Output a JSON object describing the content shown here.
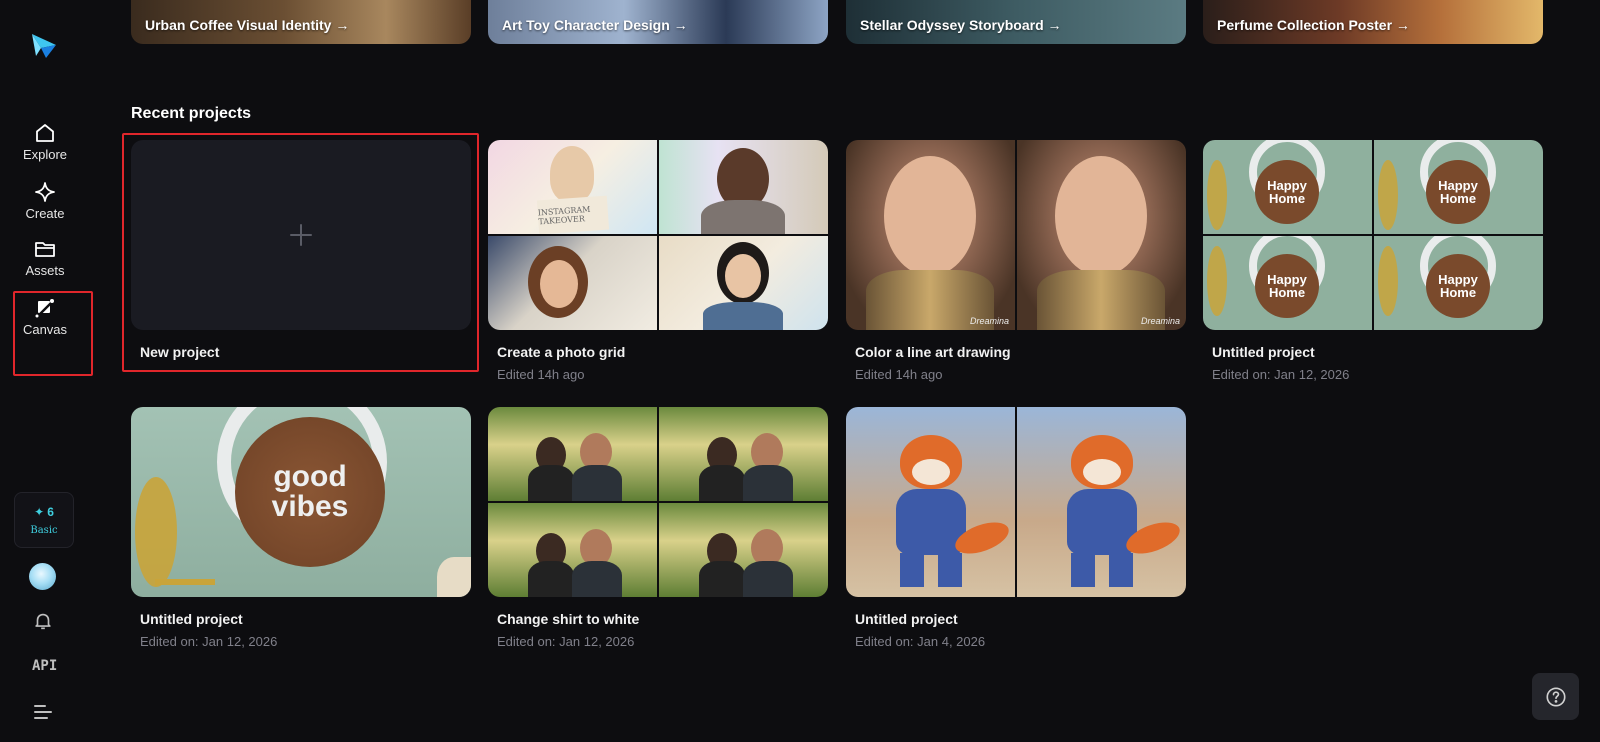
{
  "sidebar": {
    "items": [
      {
        "label": "Explore",
        "icon": "home-icon"
      },
      {
        "label": "Create",
        "icon": "sparkle-icon"
      },
      {
        "label": "Assets",
        "icon": "folder-icon"
      },
      {
        "label": "Canvas",
        "icon": "canvas-icon"
      }
    ],
    "credits": {
      "count": "6",
      "plan": "Basic"
    },
    "api_label": "API"
  },
  "banners": [
    {
      "label": "Urban Coffee Visual Identity →"
    },
    {
      "label": "Art Toy Character Design →"
    },
    {
      "label": "Stellar Odyssey Storyboard →"
    },
    {
      "label": "Perfume Collection Poster →"
    }
  ],
  "recent": {
    "title": "Recent projects",
    "new_project": {
      "label": "New project"
    },
    "projects": [
      {
        "title": "Create a photo grid",
        "subtitle": "Edited 14h ago"
      },
      {
        "title": "Color a line art drawing",
        "subtitle": "Edited 14h ago"
      },
      {
        "title": "Untitled project",
        "subtitle": "Edited on: Jan 12, 2026"
      },
      {
        "title": "Untitled project",
        "subtitle": "Edited on: Jan 12, 2026"
      },
      {
        "title": "Change shirt to white",
        "subtitle": "Edited on: Jan 12, 2026"
      },
      {
        "title": "Untitled project",
        "subtitle": "Edited on: Jan 4, 2026"
      }
    ],
    "thumb_text": {
      "happy_home_line1": "Happy",
      "happy_home_line2": "Home",
      "good_vibes_line1": "good",
      "good_vibes_line2": "vibes",
      "watermark": "Dreamina",
      "instagram_sign": "INSTAGRAM TAKEOVER"
    }
  },
  "colors": {
    "background": "#0d0d10",
    "highlight": "#e0262b",
    "accent": "#3fd0e0",
    "card_bg": "#1a1b22"
  }
}
